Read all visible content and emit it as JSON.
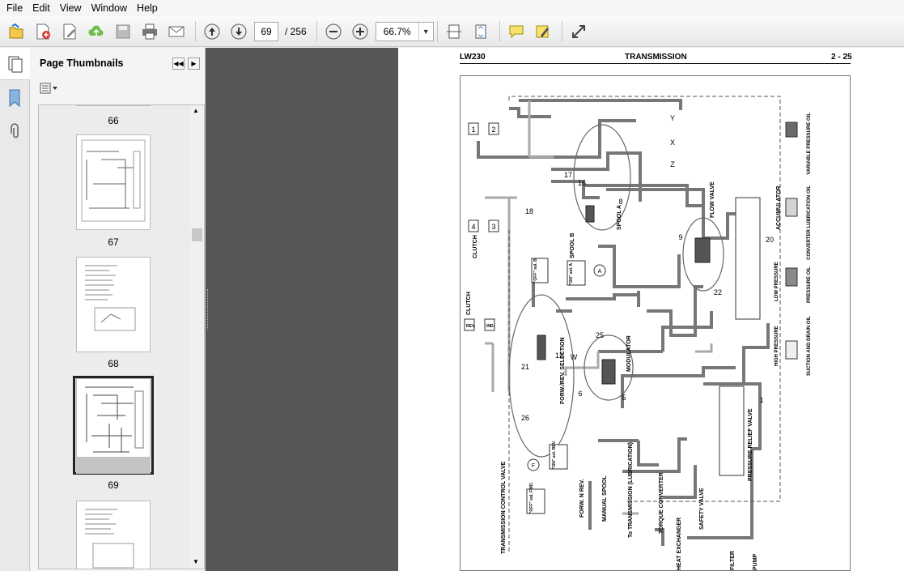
{
  "menu": [
    "File",
    "Edit",
    "View",
    "Window",
    "Help"
  ],
  "toolbar": {
    "page_current": "69",
    "page_total": "/ 256",
    "zoom": "66.7%",
    "icons": [
      "open-icon",
      "create-pdf-icon",
      "edit-icon",
      "upload-icon",
      "save-icon",
      "print-icon",
      "email-icon",
      "prev-page-icon",
      "next-page-icon",
      "zoom-out-icon",
      "zoom-in-icon",
      "fit-width-icon",
      "fit-page-icon",
      "comment-icon",
      "highlight-icon",
      "fullscreen-icon"
    ]
  },
  "thumbnails": {
    "title": "Page Thumbnails",
    "pages": [
      "66",
      "67",
      "68",
      "69"
    ],
    "selected": "69"
  },
  "document": {
    "header_left": "LW230",
    "header_center": "TRANSMISSION",
    "header_right": "2 - 25",
    "labels": {
      "n1": "1",
      "n2": "2",
      "n3": "3",
      "n4": "4",
      "clutch1": "CLUTCH",
      "clutch2": "CLUTCH",
      "rev": "REV.",
      "ind": "IND.",
      "spool_b": "SPOOL B",
      "spool_a": "SPOOL A",
      "n16": "16",
      "n17": "17",
      "n18": "18",
      "n8": "8",
      "x": "X",
      "y": "Y",
      "z": "Z",
      "flow_valve": "FLOW VALVE",
      "n9": "9",
      "n20": "20",
      "n22": "22",
      "accumulator": "ACCUMULATOR",
      "off_b": "\"OFF\" sol. B",
      "on_a": "\"ON\" sol. A",
      "a": "A",
      "n25": "25",
      "modulator": "MODULATOR",
      "n6": "6",
      "n5": "5",
      "n21": "21",
      "n12": "12",
      "w": "W",
      "n26": "26",
      "forw_rev": "FORW./REV. SELECTION",
      "f": "F",
      "on_rev": "\"ON\" sol. REV.",
      "off_fwd": "\"OFF\" sol. FWD.",
      "forw_n_rev": "FORW. N REV.",
      "manual_spool": "MANUAL SPOOL",
      "tcv": "TRANSMISSION CONTROL VALVE",
      "to_trans": "To TRANSMISSION (LUBRICATION)",
      "torque_conv": "TORQUE CONVERTER",
      "heat_ex": "HEAT EXCHANGER",
      "safety": "SAFETY VALVE",
      "filter": "FILTER",
      "pump": "PUMP",
      "prv": "PRESSURE RELIEF VALVE",
      "n1b": "1"
    },
    "legend": [
      {
        "label": "VARIABLE PRESSURE OIL",
        "color": "#6a6a6a"
      },
      {
        "label": "CONVERTER LUBRICATION OIL",
        "color": "#d4d4d4"
      },
      {
        "label": "LOW PRESSURE",
        "color": "#ffffff"
      },
      {
        "label": "PRESSURE OIL",
        "color": "#8a8a8a"
      },
      {
        "label": "HIGH PRESSURE",
        "color": "#ffffff"
      },
      {
        "label": "SUCTION AND DRAIN OIL",
        "color": "#f0f0f0"
      }
    ]
  }
}
